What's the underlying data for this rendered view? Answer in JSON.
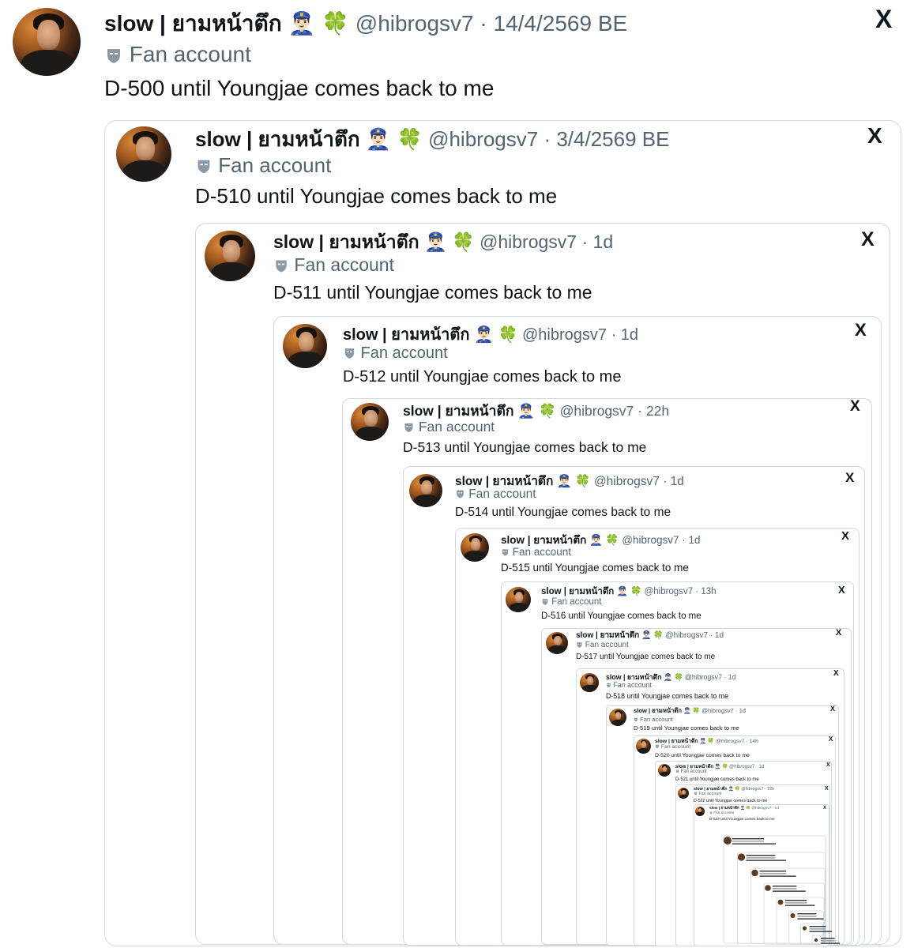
{
  "display_name": "slow | ยามหน้าตึก",
  "emoji_police": "👮🏻‍♂️",
  "emoji_clover": "🍀",
  "handle": "@hibrogsv7",
  "separator": "·",
  "badge_label": "Fan account",
  "x_logo": "X",
  "tweets": [
    {
      "time": "14/4/2569 BE",
      "text": "D-500 until Youngjae comes back to me"
    },
    {
      "time": "3/4/2569 BE",
      "text": "D-510 until Youngjae comes back to me"
    },
    {
      "time": "1d",
      "text": "D-511 until Youngjae comes back to me"
    },
    {
      "time": "1d",
      "text": "D-512 until Youngjae comes back to me"
    },
    {
      "time": "22h",
      "text": "D-513 until Youngjae comes back to me"
    },
    {
      "time": "1d",
      "text": "D-514 until Youngjae comes back to me"
    },
    {
      "time": "1d",
      "text": "D-515 until Youngjae comes back to me"
    },
    {
      "time": "13h",
      "text": "D-516 until Youngjae comes back to me"
    },
    {
      "time": "1d",
      "text": "D-517 until Youngjae comes back to me"
    },
    {
      "time": "1d",
      "text": "D-518 until Youngjae comes back to me"
    },
    {
      "time": "1d",
      "text": "D-519 until Youngjae comes back to me"
    },
    {
      "time": "14h",
      "text": "D-520 until Youngjae comes back to me"
    },
    {
      "time": "1d",
      "text": "D-521 until Youngjae comes back to me"
    },
    {
      "time": "22h",
      "text": "D-522 until Youngjae comes back to me"
    },
    {
      "time": "1d",
      "text": "D-523 until Youngjae comes back to me"
    }
  ]
}
